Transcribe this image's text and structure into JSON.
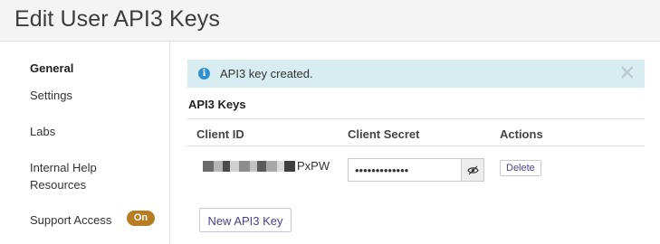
{
  "page": {
    "title": "Edit User API3 Keys"
  },
  "sidebar": {
    "items": [
      {
        "label": "General"
      },
      {
        "label": "Settings"
      },
      {
        "label": "Labs"
      },
      {
        "label": "Internal Help Resources"
      },
      {
        "label": "Support Access",
        "badge": "On"
      }
    ]
  },
  "alert": {
    "message": "API3 key created.",
    "icon": "info-icon",
    "dismiss_icon": "close-icon"
  },
  "keys": {
    "section_title": "API3 Keys",
    "columns": [
      "Client ID",
      "Client Secret",
      "Actions"
    ],
    "rows": [
      {
        "client_id_visible_suffix": "PxPW",
        "client_secret": "•••••••••••••",
        "toggle_icon": "eye-slash-icon",
        "delete_label": "Delete"
      }
    ],
    "new_key_label": "New API3 Key"
  },
  "colors": {
    "alert_background": "#d8edf1",
    "info_icon": "#2f8fd1",
    "badge": "#b87d22",
    "button_text": "#4b3f8a"
  }
}
